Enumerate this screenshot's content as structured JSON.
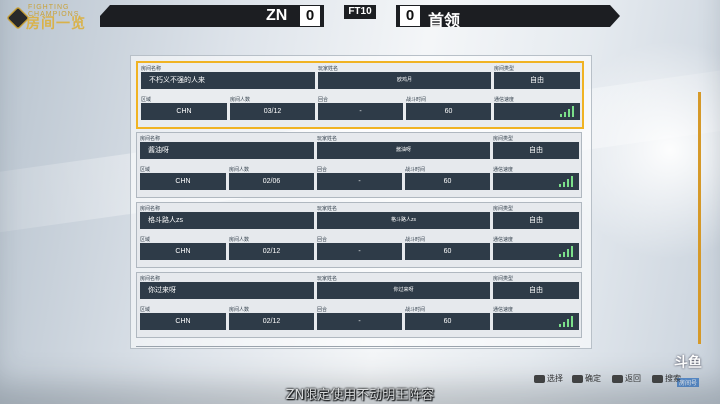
{
  "logo": {
    "line1": "FIGHTING CHAMPIONS",
    "line2": "房间一览"
  },
  "scoreboard": {
    "left_name": "ZN",
    "left_score": "0",
    "format": "FT10",
    "right_score": "0",
    "right_name": "首领"
  },
  "labels": {
    "room_name": "房间名称",
    "player_name": "玩家姓名",
    "room_type": "房间类型",
    "region": "区域",
    "room_count": "房间人数",
    "rounds": "回合",
    "battle_time": "战斗时间",
    "connection": "通信速度"
  },
  "rooms": [
    {
      "name": "不朽义不强的人来",
      "player": "欧鸡月",
      "type": "自由",
      "region": "CHN",
      "count": "03/12",
      "rounds": "-",
      "time": "60",
      "signal_bars": 4
    },
    {
      "name": "酱油呀",
      "player": "酱油呀",
      "type": "自由",
      "region": "CHN",
      "count": "02/06",
      "rounds": "-",
      "time": "60",
      "signal_bars": 4
    },
    {
      "name": "格斗路人zs",
      "player": "格斗路人zs",
      "type": "自由",
      "region": "CHN",
      "count": "02/12",
      "rounds": "-",
      "time": "60",
      "signal_bars": 4
    },
    {
      "name": "你过来呀",
      "player": "你过来呀",
      "type": "自由",
      "region": "CHN",
      "count": "02/12",
      "rounds": "-",
      "time": "60",
      "signal_bars": 4
    }
  ],
  "subtitle": "ZN限定使用不动明王阵容",
  "controls": [
    {
      "label": "选择",
      "icon": "button-glyph-icon"
    },
    {
      "label": "确定",
      "icon": "button-glyph-icon"
    },
    {
      "label": "返回",
      "icon": "button-glyph-icon"
    },
    {
      "label": "搜索",
      "icon": "button-glyph-icon"
    }
  ],
  "watermark": {
    "brand": "斗鱼",
    "room": "房间号"
  },
  "colors": {
    "accent": "#f0b323",
    "box": "#2e3b48",
    "signal": "#7be08a"
  }
}
